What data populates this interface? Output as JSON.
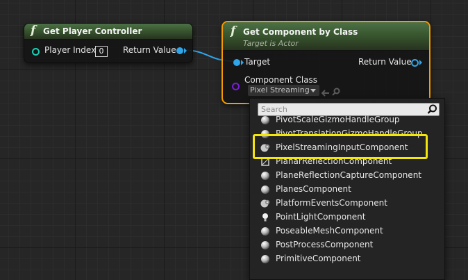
{
  "colors": {
    "accent_selection": "#f59c00",
    "callout_highlight": "#f3e60d",
    "object_pin": "#2fa6ea",
    "int_pin": "#1bd1b4",
    "class_pin": "#7a1ed6",
    "function_header": "#39572f"
  },
  "node_get_player_controller": {
    "icon": "function-icon",
    "icon_glyph": "f",
    "title": "Get Player Controller",
    "input_pin_label": "Player Index",
    "input_value": "0",
    "output_pin_label": "Return Value"
  },
  "node_get_component_by_class": {
    "icon": "function-icon",
    "icon_glyph": "f",
    "title": "Get Component by Class",
    "subtitle": "Target is Actor",
    "target_pin_label": "Target",
    "return_pin_label": "Return Value",
    "component_class_label": "Component Class",
    "component_class_value": "Pixel Streaming"
  },
  "class_picker": {
    "search_placeholder": "Search",
    "items": [
      {
        "label": "PivotScaleGizmoHandleGroup",
        "icon": "sphere-icon"
      },
      {
        "label": "PivotTranslationGizmoHandleGroup",
        "icon": "sphere-icon"
      },
      {
        "label": "PixelStreamingInputComponent",
        "icon": "gear-sphere-icon"
      },
      {
        "label": "PlanarReflectionComponent",
        "icon": "mirror-icon"
      },
      {
        "label": "PlaneReflectionCaptureComponent",
        "icon": "sphere-icon"
      },
      {
        "label": "PlanesComponent",
        "icon": "sphere-icon"
      },
      {
        "label": "PlatformEventsComponent",
        "icon": "gear-sphere-icon"
      },
      {
        "label": "PointLightComponent",
        "icon": "lightbulb-icon"
      },
      {
        "label": "PoseableMeshComponent",
        "icon": "sphere-icon"
      },
      {
        "label": "PostProcessComponent",
        "icon": "sphere-icon"
      },
      {
        "label": "PrimitiveComponent",
        "icon": "sphere-icon"
      }
    ]
  }
}
